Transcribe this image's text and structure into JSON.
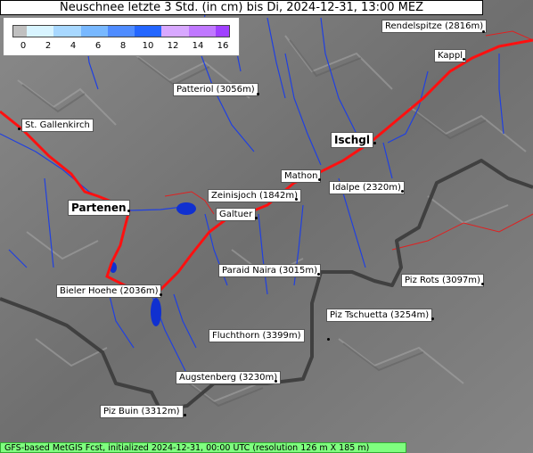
{
  "title": "Neuschnee letzte 3 Std. (in cm) bis Di, 2024-12-31, 13:00 MEZ",
  "legend": {
    "ticks": [
      "0",
      "2",
      "4",
      "6",
      "8",
      "10",
      "12",
      "14",
      "16"
    ],
    "colors": [
      "#c0c0c0",
      "#d8f4ff",
      "#a8d8ff",
      "#78b8ff",
      "#4f8cff",
      "#2466ff",
      "#d8a8ff",
      "#c078ff",
      "#a040ff"
    ]
  },
  "places": [
    {
      "name": "Rendelspitze (2816m)"
    },
    {
      "name": "Kappl"
    },
    {
      "name": "Patteriol (3056m)"
    },
    {
      "name": "St. Gallenkirch"
    },
    {
      "name": "Ischgl"
    },
    {
      "name": "Mathon"
    },
    {
      "name": "Idalpe (2320m)"
    },
    {
      "name": "Zeinisjoch (1842m)"
    },
    {
      "name": "Partenen"
    },
    {
      "name": "Galtuer"
    },
    {
      "name": "Paraid Naira (3015m)"
    },
    {
      "name": "Piz Rots (3097m)"
    },
    {
      "name": "Bieler Hoehe (2036m)"
    },
    {
      "name": "Piz Tschuetta (3254m)"
    },
    {
      "name": "Fluchthorn (3399m)"
    },
    {
      "name": "Augstenberg (3230m)"
    },
    {
      "name": "Piz Buin (3312m)"
    }
  ],
  "footer": "GFS-based MetGIS Fcst, initialized 2024-12-31, 00:00 UTC  (resolution 126 m X 185 m)",
  "colors": {
    "river": "#2040e0",
    "road": "#ff1010",
    "border": "#404040",
    "lake": "#1030d0",
    "terrain": "#7d7d7d"
  }
}
